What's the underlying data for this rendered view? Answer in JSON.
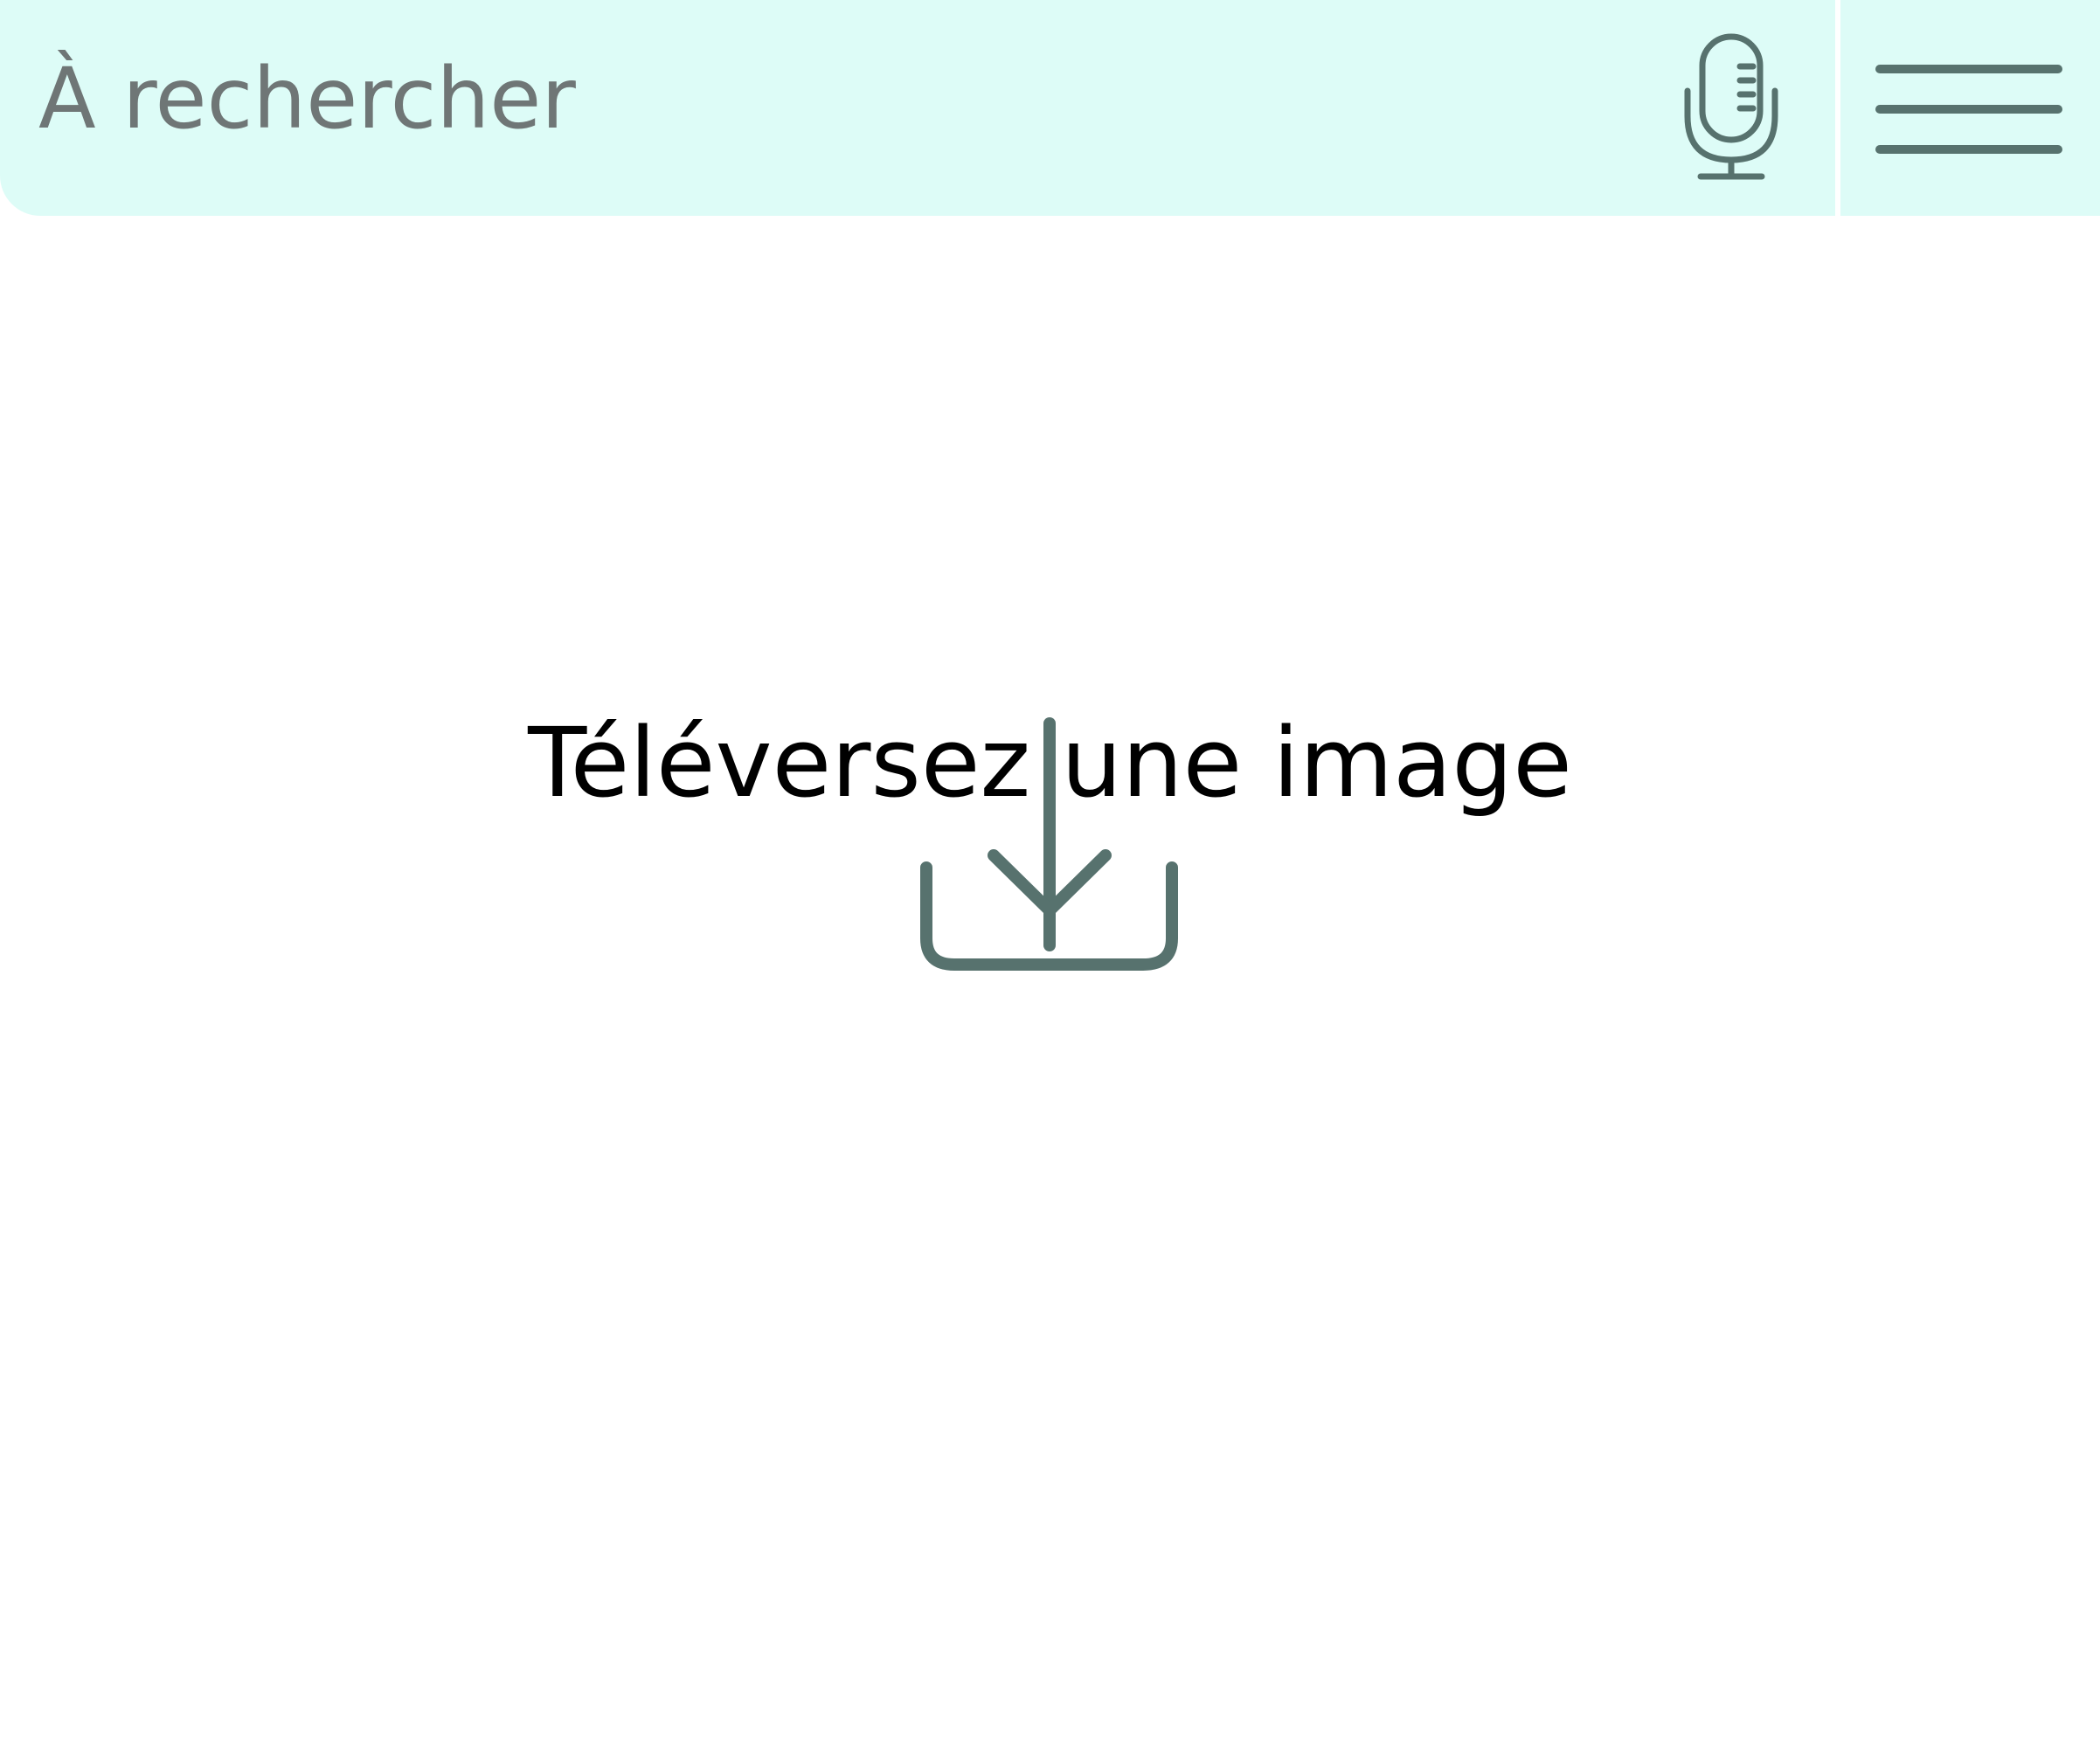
{
  "colors": {
    "header_background": "#ddfcf7",
    "icon_color": "#57726e",
    "placeholder_color": "#6f7676",
    "title_color": "#000000",
    "page_background": "#ffffff"
  },
  "header": {
    "search": {
      "placeholder": "À rechercher",
      "value": ""
    },
    "mic_icon": "microphone-icon",
    "menu_icon": "hamburger-menu-icon"
  },
  "main": {
    "upload_title": "Téléversez une image",
    "upload_icon": "download-tray-icon"
  }
}
